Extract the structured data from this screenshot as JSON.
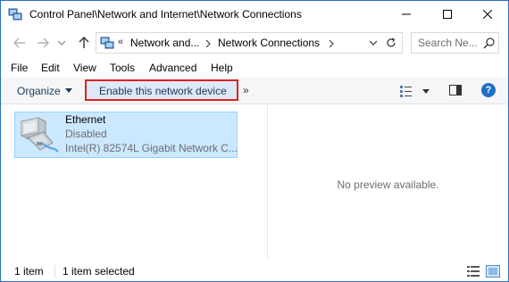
{
  "window": {
    "title": "Control Panel\\Network and Internet\\Network Connections"
  },
  "nav": {
    "address_prefix": "«",
    "address_segments": [
      "Network and...",
      "Network Connections"
    ],
    "search_placeholder": "Search Ne..."
  },
  "menu": {
    "items": [
      "File",
      "Edit",
      "View",
      "Tools",
      "Advanced",
      "Help"
    ]
  },
  "toolbar": {
    "organize_label": "Organize",
    "enable_label": "Enable this network device",
    "more_label": "»",
    "help_label": "?",
    "highlight_color": "#e02020"
  },
  "items": [
    {
      "name": "Ethernet",
      "status": "Disabled",
      "device": "Intel(R) 82574L Gigabit Network C..."
    }
  ],
  "preview": {
    "text": "No preview available."
  },
  "statusbar": {
    "count": "1 item",
    "selected": "1 item selected"
  },
  "colors": {
    "selection_bg": "#cce8ff",
    "selection_border": "#99d1ff",
    "accent": "#1f6fc5"
  }
}
